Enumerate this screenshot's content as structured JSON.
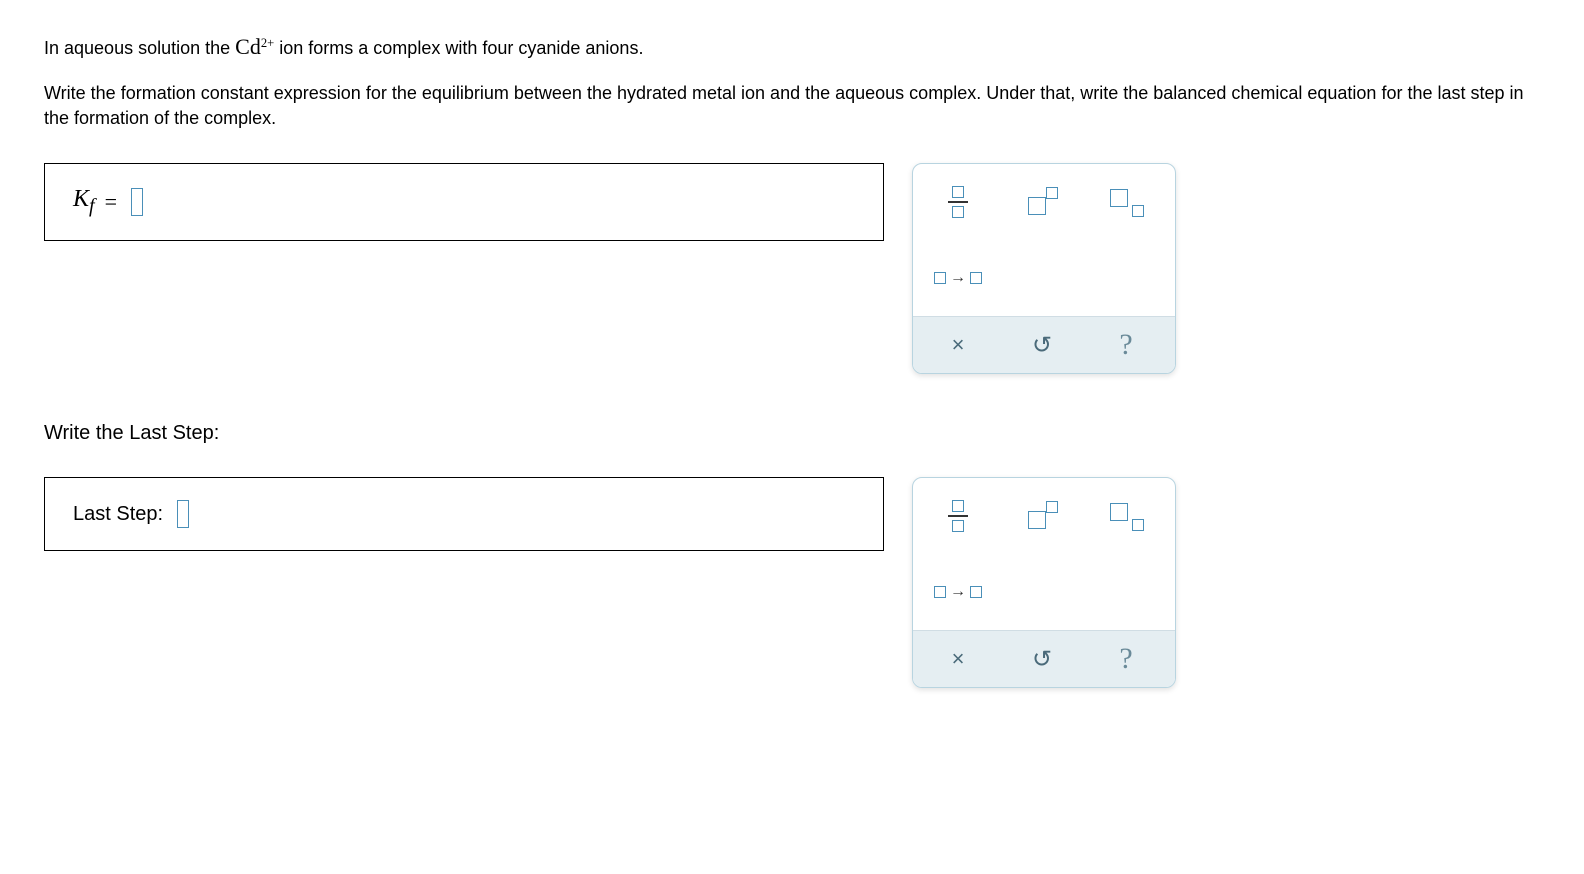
{
  "problem": {
    "line1_pre": "In aqueous solution the ",
    "line1_ion": "Cd",
    "line1_charge": "2+",
    "line1_post": " ion forms a complex with four cyanide anions.",
    "line2": "Write the formation constant expression for the equilibrium between the hydrated metal ion and the aqueous complex. Under that, write the balanced chemical equation for the last step in the formation of the complex."
  },
  "kf": {
    "symbol": "K",
    "subscript": "f",
    "equals": "="
  },
  "laststep": {
    "section_label": "Write the Last Step:",
    "field_label": "Last Step:"
  },
  "toolbox": {
    "fraction": "fraction",
    "superscript": "superscript",
    "subscript": "subscript",
    "reaction_arrow": "reaction-arrow",
    "clear": "×",
    "undo": "↺",
    "help": "?"
  }
}
